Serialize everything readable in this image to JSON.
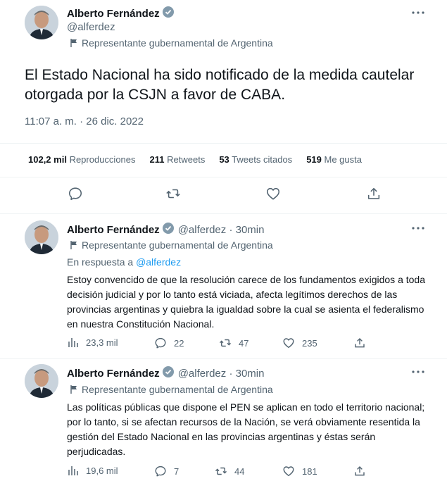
{
  "main_tweet": {
    "author_name": "Alberto Fernández",
    "handle": "@alferdez",
    "label": "Representante gubernamental de Argentina",
    "text": "El Estado Nacional ha sido notificado de la medida cautelar otorgada por la CSJN a favor de CABA.",
    "timestamp": "11:07 a. m. · 26 dic. 2022",
    "stats": {
      "views_count": "102,2 mil",
      "views_label": "Reproducciones",
      "retweets_count": "211",
      "retweets_label": "Retweets",
      "quotes_count": "53",
      "quotes_label": "Tweets citados",
      "likes_count": "519",
      "likes_label": "Me gusta"
    }
  },
  "replies": [
    {
      "author_name": "Alberto Fernández",
      "handle_time": "@alferdez · 30min",
      "label": "Representante gubernamental de Argentina",
      "reply_to_prefix": "En respuesta a",
      "reply_to_handle": "@alferdez",
      "text": "Estoy convencido de que la resolución carece de los fundamentos exigidos a toda decisión judicial y por lo tanto está viciada, afecta legítimos derechos de las provincias argentinas y quiebra la igualdad sobre la cual se asienta el federalismo en nuestra Constitución Nacional.",
      "views": "23,3 mil",
      "replies": "22",
      "retweets": "47",
      "likes": "235"
    },
    {
      "author_name": "Alberto Fernández",
      "handle_time": "@alferdez · 30min",
      "label": "Representante gubernamental de Argentina",
      "text": "Las políticas públicas que dispone el PEN se aplican en todo el territorio nacional; por lo tanto, si se afectan recursos de la Nación, se verá obviamente resentida la gestión del Estado Nacional en las provincias argentinas y éstas serán perjudicadas.",
      "views": "19,6 mil",
      "replies": "7",
      "retweets": "44",
      "likes": "181"
    }
  ]
}
